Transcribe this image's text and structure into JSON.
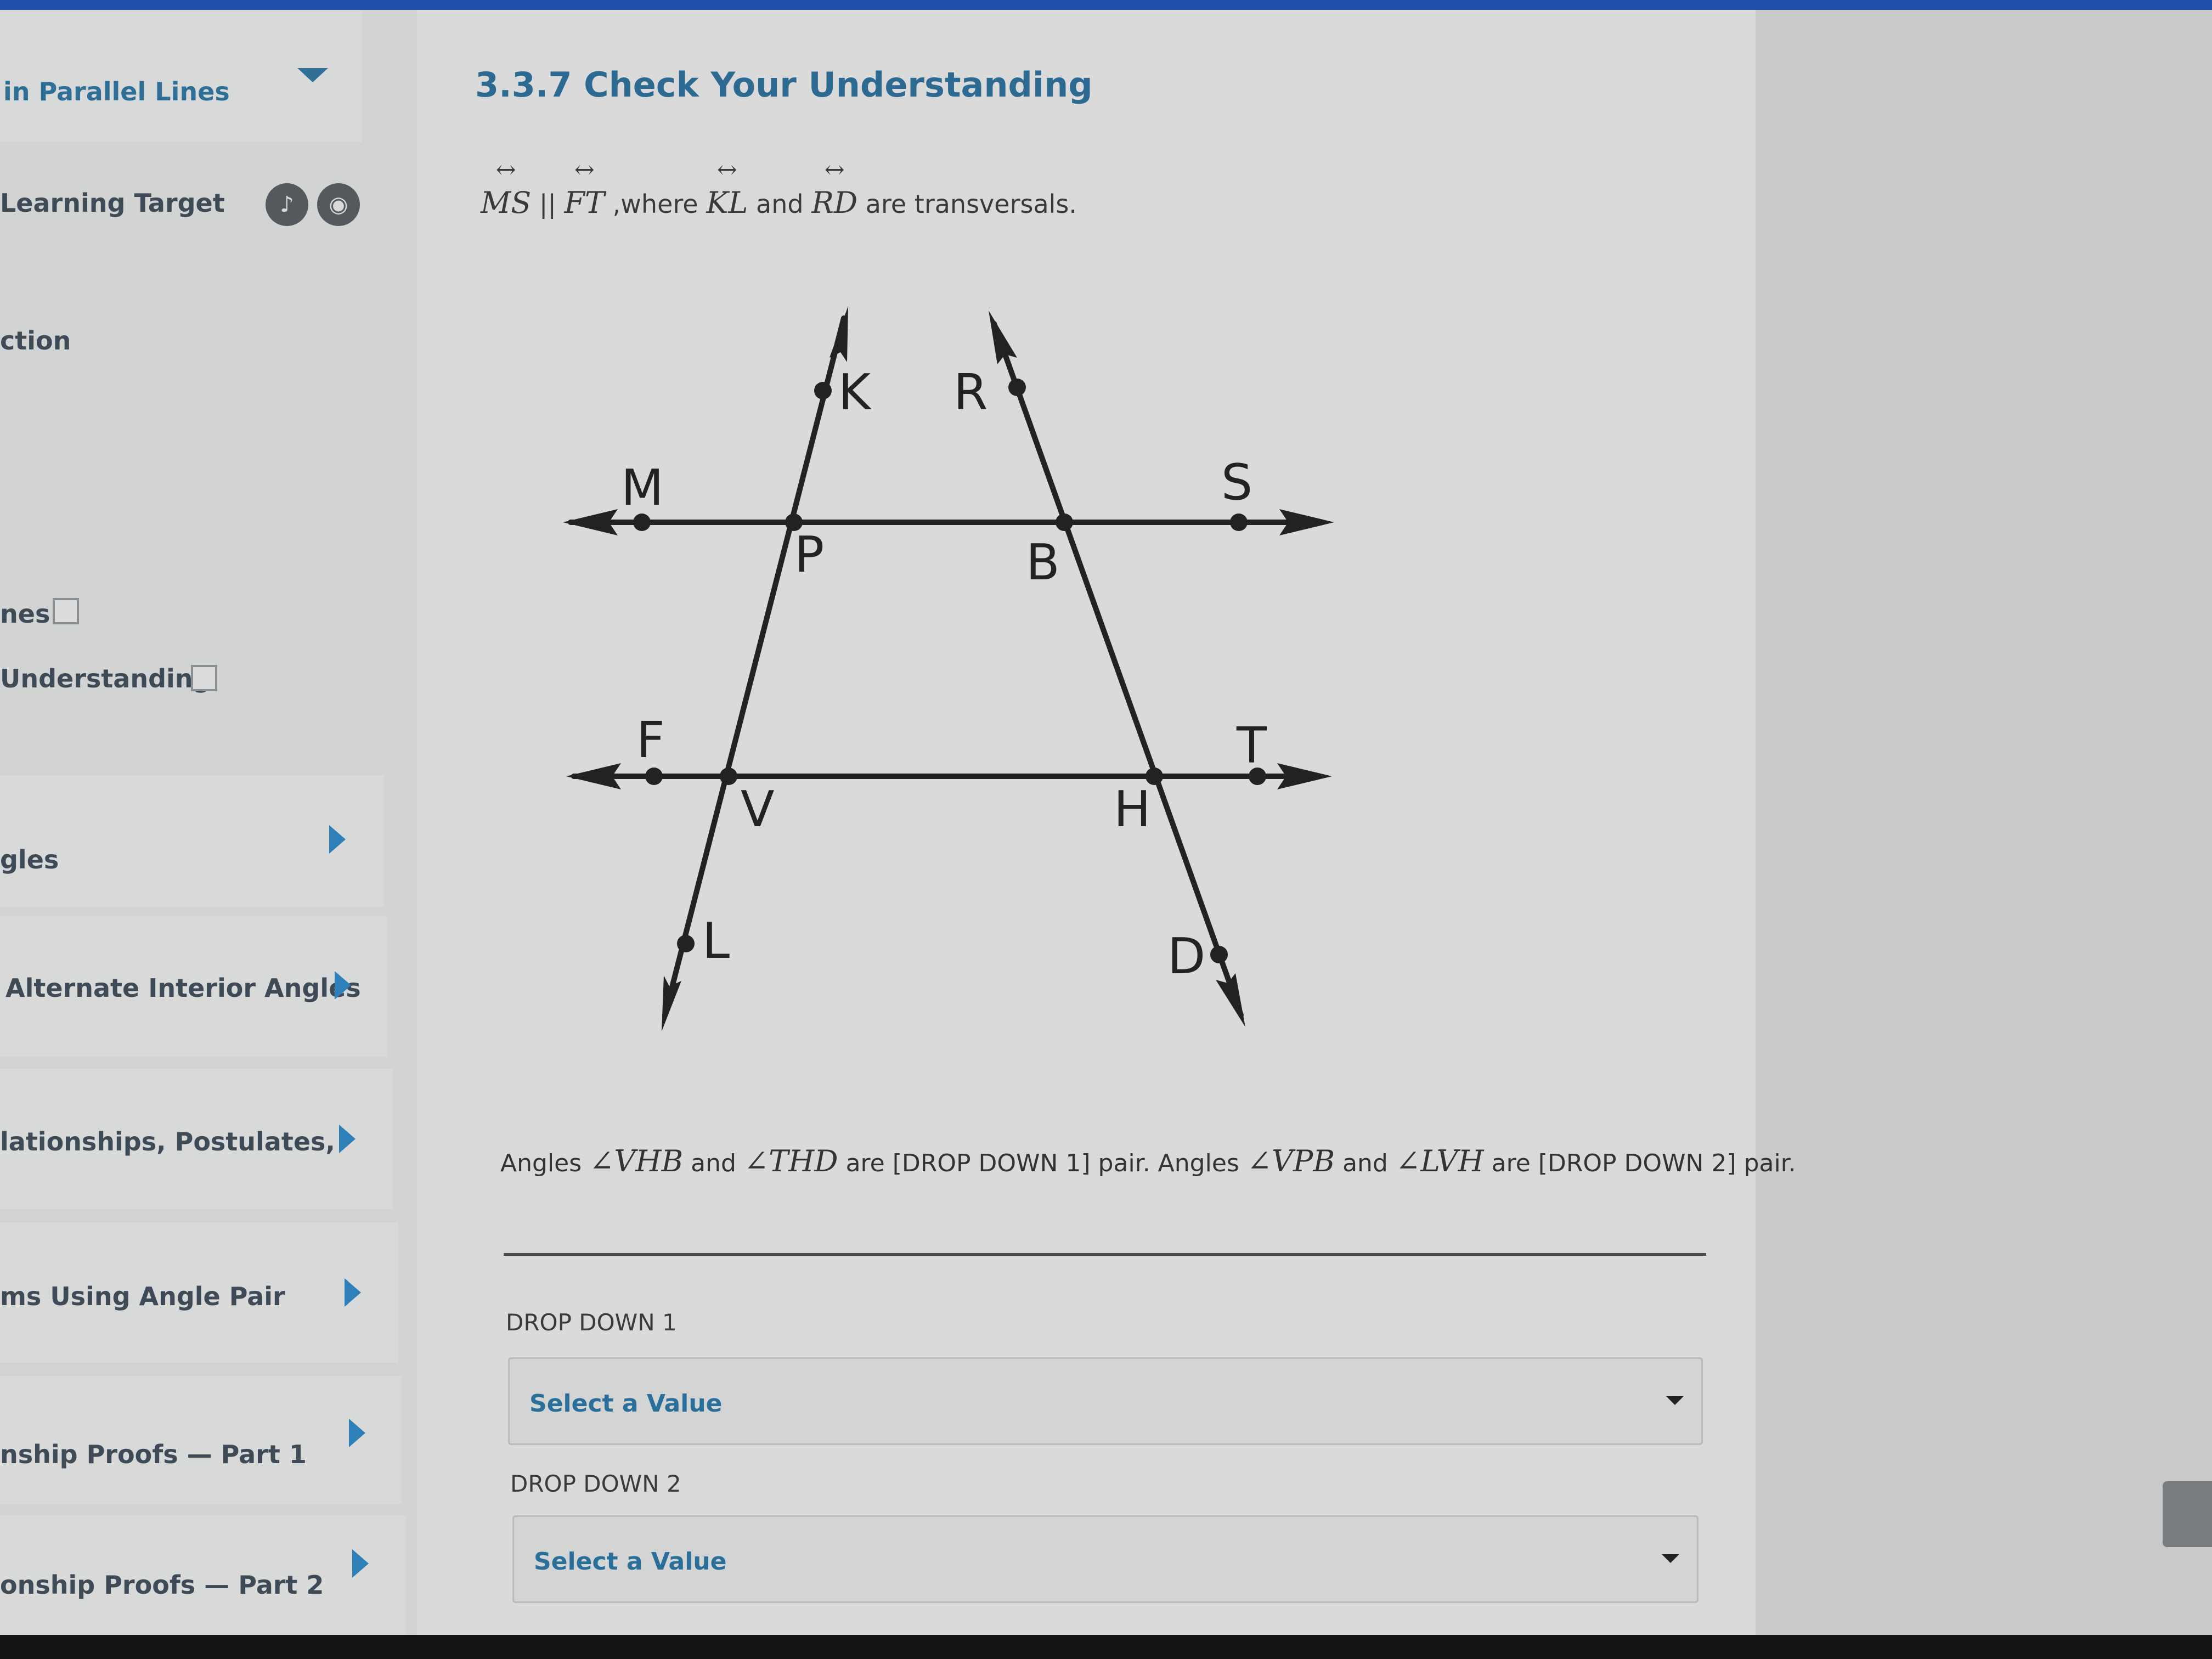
{
  "sidebar": {
    "module_title": "in Parallel Lines",
    "learning_target": "Learning Target",
    "section": "ction",
    "notes": "nes",
    "check_understanding": "Understanding",
    "items": [
      {
        "label": "gles"
      },
      {
        "label": "Alternate Interior Angles"
      },
      {
        "label": "lationships, Postulates,"
      },
      {
        "label": "ms Using Angle Pair"
      },
      {
        "label": "nship Proofs — Part 1"
      },
      {
        "label": "onship Proofs — Part 2"
      }
    ]
  },
  "main": {
    "title": "3.3.7 Check Your Understanding",
    "given": {
      "line1": "MS",
      "parallel": " || ",
      "line2": "FT",
      "where": " ,where ",
      "t1": "KL",
      "and": " and ",
      "t2": "RD",
      "rest": " are transversals."
    },
    "figure_labels": {
      "K": "K",
      "R": "R",
      "M": "M",
      "S": "S",
      "P": "P",
      "B": "B",
      "F": "F",
      "T": "T",
      "V": "V",
      "H": "H",
      "L": "L",
      "D": "D"
    },
    "question": {
      "p1": "Angles ",
      "a1": "∠VHB",
      "p2": " and ",
      "a2": "∠THD",
      "p3": " are [DROP DOWN 1] pair. Angles ",
      "a3": "∠VPB",
      "p4": " and ",
      "a4": "∠LVH",
      "p5": " are [DROP DOWN 2] pair."
    },
    "dropdown1": {
      "label": "DROP DOWN 1",
      "value": "Select a Value"
    },
    "dropdown2": {
      "label": "DROP DOWN 2",
      "value": "Select a Value"
    }
  },
  "colors": {
    "top_bar": "#1f4fa8",
    "title": "#2d6a92",
    "link": "#2a6f99",
    "arrow": "#2f7fb8"
  },
  "icons": [
    "chevron-down-icon",
    "play-right-icon",
    "audio-icon",
    "settings-icon",
    "checkbox-icon",
    "caret-down-icon"
  ]
}
